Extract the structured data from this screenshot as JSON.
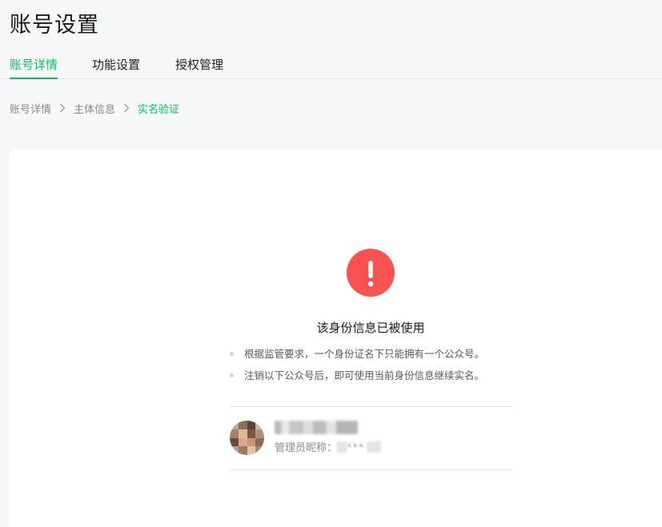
{
  "header": {
    "title": "账号设置"
  },
  "tabs": [
    {
      "label": "账号详情",
      "active": true
    },
    {
      "label": "功能设置",
      "active": false
    },
    {
      "label": "授权管理",
      "active": false
    }
  ],
  "breadcrumb": [
    {
      "label": "账号详情"
    },
    {
      "label": "主体信息"
    },
    {
      "label": "实名验证",
      "current": true
    }
  ],
  "notice": {
    "icon": "exclamation-circle-icon",
    "icon_color": "#fa5151",
    "title": "该身份信息已被使用",
    "tips": [
      "根据监管要求，一个身份证名下只能拥有一个公众号。",
      "注销以下公众号后，即可使用当前身份信息继续实名。"
    ]
  },
  "account": {
    "name": "",
    "admin_label": "管理员昵称：",
    "admin_value": "***"
  },
  "colors": {
    "accent": "#07c160",
    "warning": "#fa5151",
    "background": "#f6f7f9"
  }
}
